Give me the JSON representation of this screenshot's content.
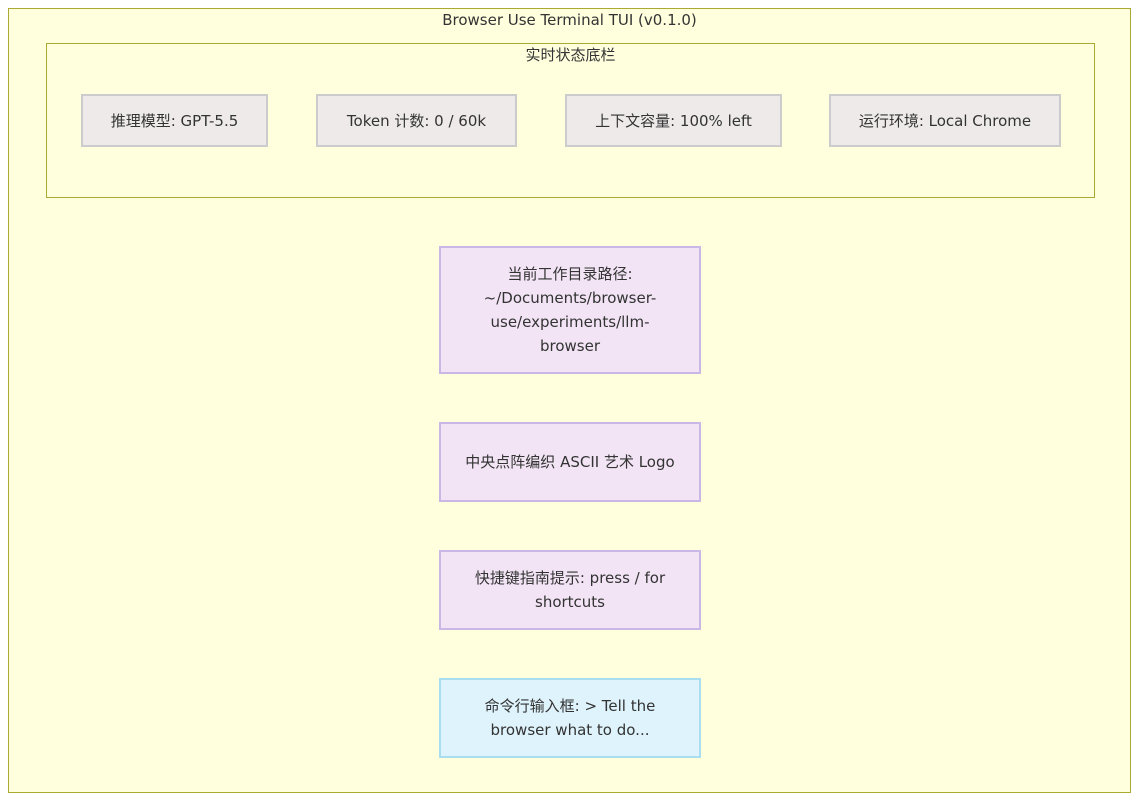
{
  "diagram": {
    "title": "Browser Use Terminal TUI (v0.1.0)",
    "status_bar": {
      "title": "实时状态底栏",
      "items": [
        {
          "label": "推理模型: GPT-5.5"
        },
        {
          "label": "Token 计数: 0 / 60k"
        },
        {
          "label": "上下文容量: 100% left"
        },
        {
          "label": "运行环境: Local Chrome"
        }
      ]
    },
    "nodes": {
      "cwd": "当前工作目录路径: ~/Documents/browser-use/experiments/llm-browser",
      "logo": "中央点阵编织 ASCII 艺术 Logo",
      "shortcuts": "快捷键指南提示: press / for shortcuts",
      "input": "命令行输入框: > Tell the browser what to do..."
    },
    "colors": {
      "outer_fill": "#ffffde",
      "outer_border": "#aaaa33",
      "chip_fill": "#eeeaea",
      "node_fill": "#f2e4f5",
      "node_border": "#c9b8e6",
      "input_fill": "#def3fc",
      "input_border": "#a9def0"
    }
  }
}
